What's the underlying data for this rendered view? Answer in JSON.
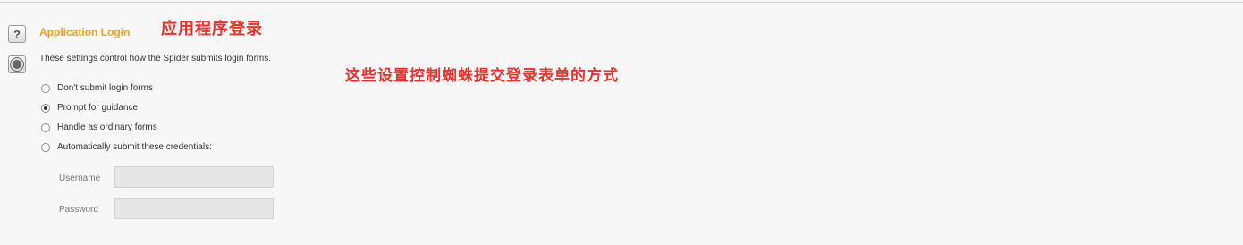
{
  "section": {
    "title": "Application Login",
    "annotation_title": "应用程序登录",
    "description": "These settings control how the Spider submits login forms.",
    "annotation_description": "这些设置控制蜘蛛提交登录表单的方式"
  },
  "options": [
    {
      "label": "Don't submit login forms",
      "selected": false
    },
    {
      "label": "Prompt for guidance",
      "selected": true
    },
    {
      "label": "Handle as ordinary forms",
      "selected": false
    },
    {
      "label": "Automatically submit these credentials:",
      "selected": false
    }
  ],
  "credentials": {
    "username_label": "Username",
    "username_value": "",
    "password_label": "Password",
    "password_value": ""
  },
  "icons": {
    "help": "help-icon",
    "settings": "settings-gear-icon"
  },
  "colors": {
    "title": "#f0a020",
    "annotation": "#e8332f"
  }
}
